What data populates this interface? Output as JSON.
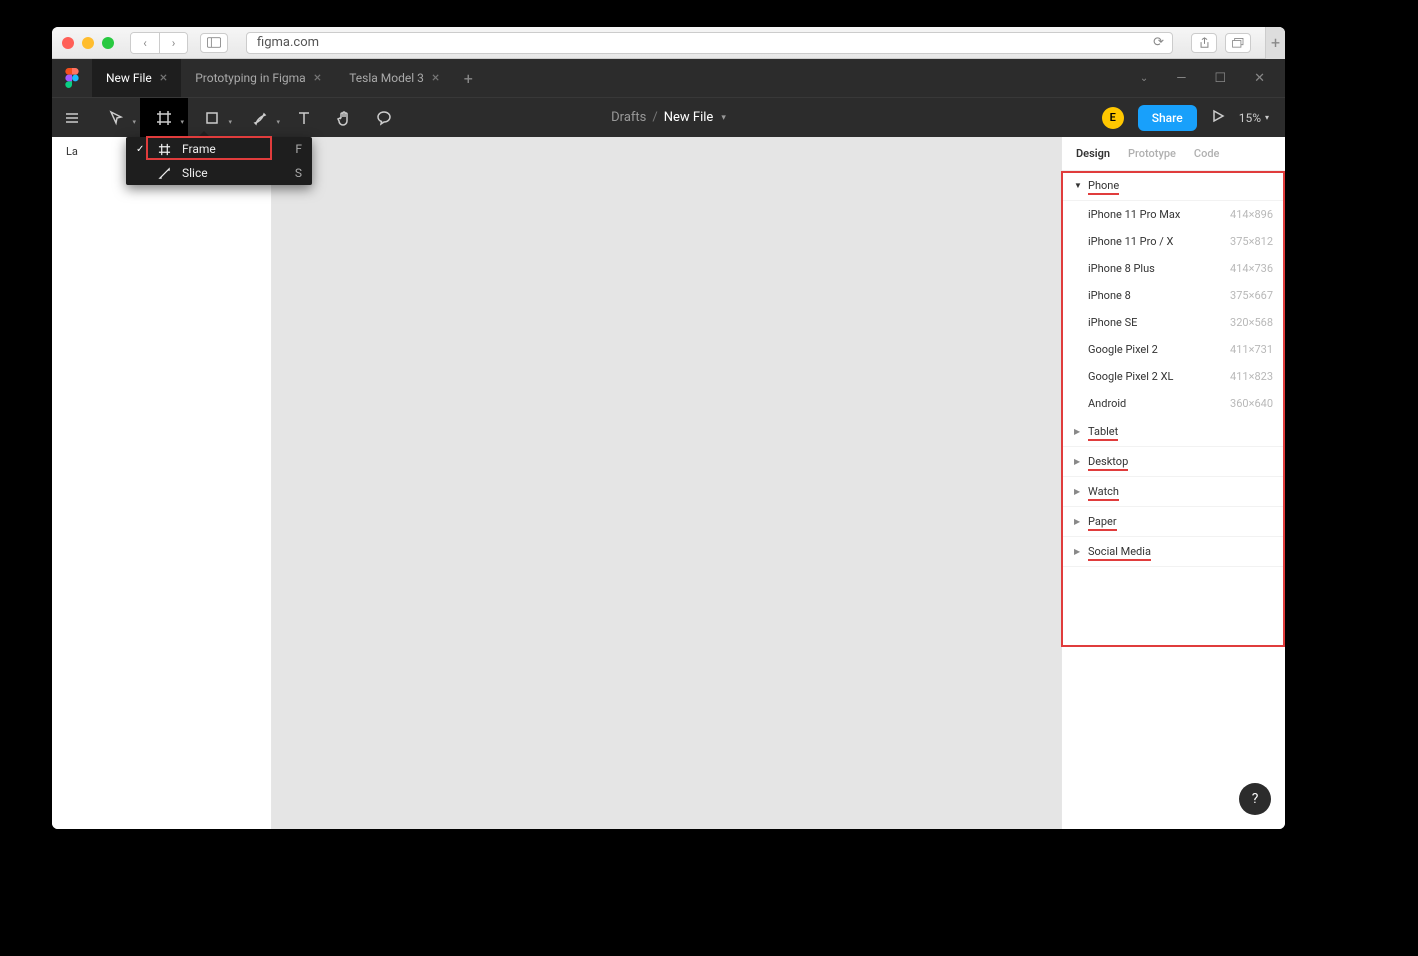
{
  "browser": {
    "url": "figma.com"
  },
  "tabs": [
    {
      "label": "New File",
      "active": true
    },
    {
      "label": "Prototyping in Figma",
      "active": false
    },
    {
      "label": "Tesla Model 3",
      "active": false
    }
  ],
  "toolbar": {
    "breadcrumb_drafts": "Drafts",
    "breadcrumb_file": "New File",
    "avatar_initial": "E",
    "share_label": "Share",
    "zoom_label": "15%"
  },
  "frame_dropdown": [
    {
      "label": "Frame",
      "shortcut": "F",
      "checked": true,
      "icon": "frame"
    },
    {
      "label": "Slice",
      "shortcut": "S",
      "checked": false,
      "icon": "slice"
    }
  ],
  "left_panel": {
    "layers_label": "La"
  },
  "right_panel": {
    "tabs": [
      {
        "label": "Design",
        "active": true
      },
      {
        "label": "Prototype",
        "active": false
      },
      {
        "label": "Code",
        "active": false
      }
    ],
    "sections": [
      {
        "label": "Phone",
        "open": true,
        "items": [
          {
            "name": "iPhone 11 Pro Max",
            "dim": "414×896"
          },
          {
            "name": "iPhone 11 Pro / X",
            "dim": "375×812"
          },
          {
            "name": "iPhone 8 Plus",
            "dim": "414×736"
          },
          {
            "name": "iPhone 8",
            "dim": "375×667"
          },
          {
            "name": "iPhone SE",
            "dim": "320×568"
          },
          {
            "name": "Google Pixel 2",
            "dim": "411×731"
          },
          {
            "name": "Google Pixel 2 XL",
            "dim": "411×823"
          },
          {
            "name": "Android",
            "dim": "360×640"
          }
        ]
      },
      {
        "label": "Tablet",
        "open": false,
        "items": []
      },
      {
        "label": "Desktop",
        "open": false,
        "items": []
      },
      {
        "label": "Watch",
        "open": false,
        "items": []
      },
      {
        "label": "Paper",
        "open": false,
        "items": []
      },
      {
        "label": "Social Media",
        "open": false,
        "items": []
      }
    ]
  },
  "help_label": "?"
}
